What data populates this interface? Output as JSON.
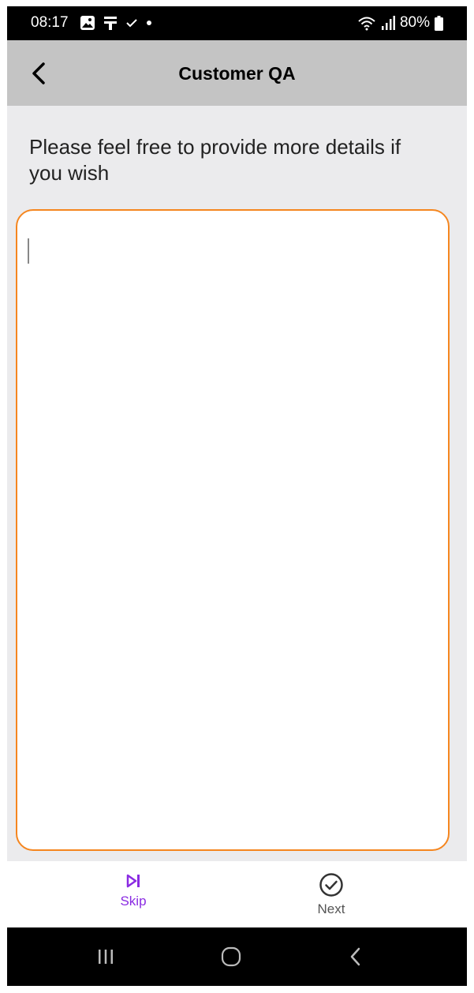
{
  "status_bar": {
    "time": "08:17",
    "battery": "80%",
    "left_icons": [
      "gallery-icon",
      "notification-icon",
      "check-icon",
      "dot-icon"
    ],
    "right_icons": [
      "wifi-icon",
      "signal-icon",
      "battery-icon"
    ]
  },
  "app_bar": {
    "title": "Customer QA",
    "back_icon": "chevron-left-icon"
  },
  "question": {
    "text": "Please feel free to provide more details if you wish"
  },
  "answer": {
    "value": "",
    "placeholder": "",
    "border_color": "#f5861f"
  },
  "actions": {
    "skip": {
      "label": "Skip",
      "icon": "skip-next-icon",
      "color": "#8a2be2"
    },
    "next": {
      "label": "Next",
      "icon": "check-circle-icon",
      "color": "#555555"
    }
  },
  "nav_bar": {
    "icons": [
      "recents-icon",
      "home-icon",
      "back-icon"
    ]
  }
}
